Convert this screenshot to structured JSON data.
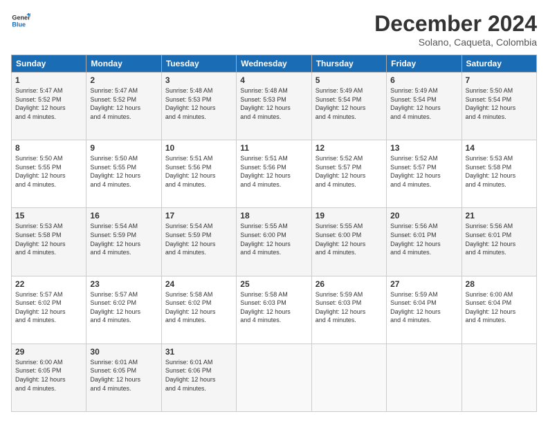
{
  "logo": {
    "line1": "General",
    "line2": "Blue"
  },
  "title": "December 2024",
  "location": "Solano, Caqueta, Colombia",
  "days_of_week": [
    "Sunday",
    "Monday",
    "Tuesday",
    "Wednesday",
    "Thursday",
    "Friday",
    "Saturday"
  ],
  "weeks": [
    [
      {
        "day": "1",
        "sunrise": "5:47 AM",
        "sunset": "5:52 PM",
        "daylight": "12 hours and 4 minutes."
      },
      {
        "day": "2",
        "sunrise": "5:47 AM",
        "sunset": "5:52 PM",
        "daylight": "12 hours and 4 minutes."
      },
      {
        "day": "3",
        "sunrise": "5:48 AM",
        "sunset": "5:53 PM",
        "daylight": "12 hours and 4 minutes."
      },
      {
        "day": "4",
        "sunrise": "5:48 AM",
        "sunset": "5:53 PM",
        "daylight": "12 hours and 4 minutes."
      },
      {
        "day": "5",
        "sunrise": "5:49 AM",
        "sunset": "5:54 PM",
        "daylight": "12 hours and 4 minutes."
      },
      {
        "day": "6",
        "sunrise": "5:49 AM",
        "sunset": "5:54 PM",
        "daylight": "12 hours and 4 minutes."
      },
      {
        "day": "7",
        "sunrise": "5:50 AM",
        "sunset": "5:54 PM",
        "daylight": "12 hours and 4 minutes."
      }
    ],
    [
      {
        "day": "8",
        "sunrise": "5:50 AM",
        "sunset": "5:55 PM",
        "daylight": "12 hours and 4 minutes."
      },
      {
        "day": "9",
        "sunrise": "5:50 AM",
        "sunset": "5:55 PM",
        "daylight": "12 hours and 4 minutes."
      },
      {
        "day": "10",
        "sunrise": "5:51 AM",
        "sunset": "5:56 PM",
        "daylight": "12 hours and 4 minutes."
      },
      {
        "day": "11",
        "sunrise": "5:51 AM",
        "sunset": "5:56 PM",
        "daylight": "12 hours and 4 minutes."
      },
      {
        "day": "12",
        "sunrise": "5:52 AM",
        "sunset": "5:57 PM",
        "daylight": "12 hours and 4 minutes."
      },
      {
        "day": "13",
        "sunrise": "5:52 AM",
        "sunset": "5:57 PM",
        "daylight": "12 hours and 4 minutes."
      },
      {
        "day": "14",
        "sunrise": "5:53 AM",
        "sunset": "5:58 PM",
        "daylight": "12 hours and 4 minutes."
      }
    ],
    [
      {
        "day": "15",
        "sunrise": "5:53 AM",
        "sunset": "5:58 PM",
        "daylight": "12 hours and 4 minutes."
      },
      {
        "day": "16",
        "sunrise": "5:54 AM",
        "sunset": "5:59 PM",
        "daylight": "12 hours and 4 minutes."
      },
      {
        "day": "17",
        "sunrise": "5:54 AM",
        "sunset": "5:59 PM",
        "daylight": "12 hours and 4 minutes."
      },
      {
        "day": "18",
        "sunrise": "5:55 AM",
        "sunset": "6:00 PM",
        "daylight": "12 hours and 4 minutes."
      },
      {
        "day": "19",
        "sunrise": "5:55 AM",
        "sunset": "6:00 PM",
        "daylight": "12 hours and 4 minutes."
      },
      {
        "day": "20",
        "sunrise": "5:56 AM",
        "sunset": "6:01 PM",
        "daylight": "12 hours and 4 minutes."
      },
      {
        "day": "21",
        "sunrise": "5:56 AM",
        "sunset": "6:01 PM",
        "daylight": "12 hours and 4 minutes."
      }
    ],
    [
      {
        "day": "22",
        "sunrise": "5:57 AM",
        "sunset": "6:02 PM",
        "daylight": "12 hours and 4 minutes."
      },
      {
        "day": "23",
        "sunrise": "5:57 AM",
        "sunset": "6:02 PM",
        "daylight": "12 hours and 4 minutes."
      },
      {
        "day": "24",
        "sunrise": "5:58 AM",
        "sunset": "6:02 PM",
        "daylight": "12 hours and 4 minutes."
      },
      {
        "day": "25",
        "sunrise": "5:58 AM",
        "sunset": "6:03 PM",
        "daylight": "12 hours and 4 minutes."
      },
      {
        "day": "26",
        "sunrise": "5:59 AM",
        "sunset": "6:03 PM",
        "daylight": "12 hours and 4 minutes."
      },
      {
        "day": "27",
        "sunrise": "5:59 AM",
        "sunset": "6:04 PM",
        "daylight": "12 hours and 4 minutes."
      },
      {
        "day": "28",
        "sunrise": "6:00 AM",
        "sunset": "6:04 PM",
        "daylight": "12 hours and 4 minutes."
      }
    ],
    [
      {
        "day": "29",
        "sunrise": "6:00 AM",
        "sunset": "6:05 PM",
        "daylight": "12 hours and 4 minutes."
      },
      {
        "day": "30",
        "sunrise": "6:01 AM",
        "sunset": "6:05 PM",
        "daylight": "12 hours and 4 minutes."
      },
      {
        "day": "31",
        "sunrise": "6:01 AM",
        "sunset": "6:06 PM",
        "daylight": "12 hours and 4 minutes."
      },
      null,
      null,
      null,
      null
    ]
  ],
  "labels": {
    "sunrise": "Sunrise:",
    "sunset": "Sunset:",
    "daylight": "Daylight:"
  }
}
